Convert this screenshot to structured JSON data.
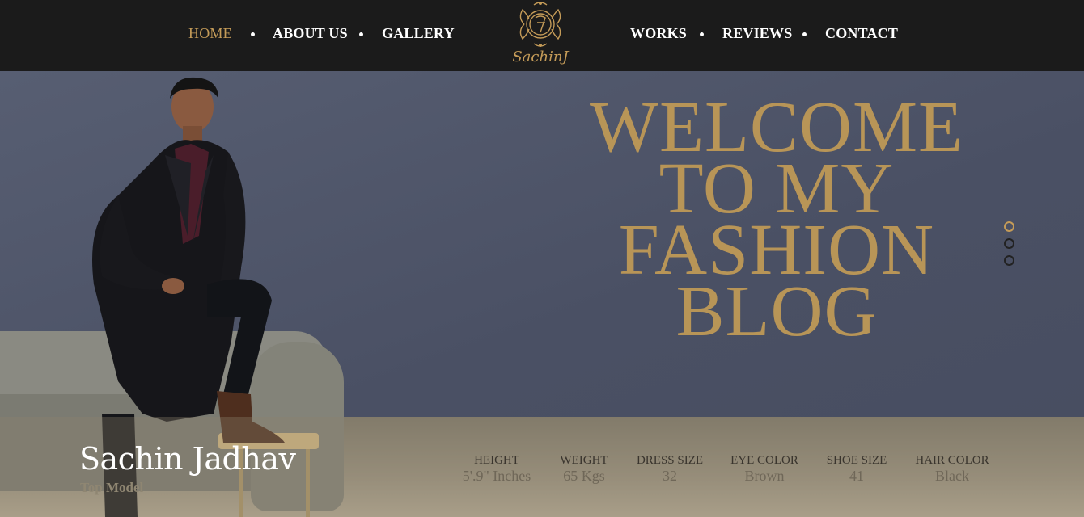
{
  "nav": {
    "left": [
      {
        "label": "HOME",
        "active": true
      },
      {
        "label": "ABOUT US"
      },
      {
        "label": "GALLERY"
      }
    ],
    "right": [
      {
        "label": "WORKS"
      },
      {
        "label": "REVIEWS"
      },
      {
        "label": "CONTACT"
      }
    ]
  },
  "logo": {
    "text": "SachinJ",
    "icon": "crest-monogram-icon"
  },
  "hero": {
    "headline": [
      "WELCOME",
      "TO MY",
      "FASHION",
      "BLOG"
    ],
    "slides": {
      "count": 3,
      "active": 1
    }
  },
  "profile": {
    "name": "Sachin Jadhav",
    "role": "Top Model",
    "stats": [
      {
        "label": "HEIGHT",
        "value": "5'.9\" Inches"
      },
      {
        "label": "WEIGHT",
        "value": "65 Kgs"
      },
      {
        "label": "DRESS SIZE",
        "value": "32"
      },
      {
        "label": "EYE COLOR",
        "value": "Brown"
      },
      {
        "label": "SHOE SIZE",
        "value": "41"
      },
      {
        "label": "HAIR COLOR",
        "value": "Black"
      }
    ]
  },
  "colors": {
    "accent": "#c49b58",
    "header_bg": "#1b1b1b",
    "hero_bg": "#4b5165"
  }
}
